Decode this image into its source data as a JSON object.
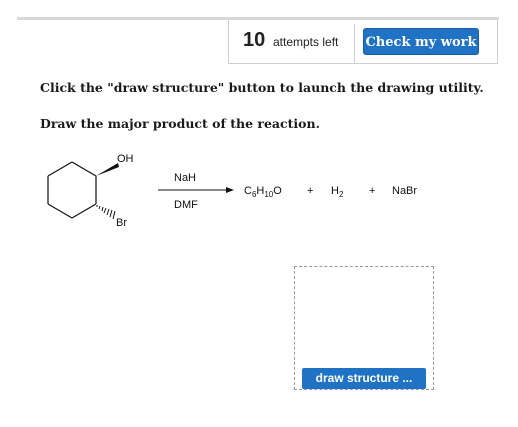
{
  "header": {
    "attempts_count": "10",
    "attempts_label": "attempts left",
    "check_button_label": "Check my work"
  },
  "instructions": {
    "line1": "Click the \"draw structure\" button to launch the drawing utility.",
    "line2": "Draw the major product of the reaction."
  },
  "reaction": {
    "reactant_oh": "OH",
    "reactant_br": "Br",
    "reagent_top": "NaH",
    "reagent_bottom": "DMF",
    "product_c": "C",
    "product_c_sub": "6",
    "product_h": "H",
    "product_h_sub": "10",
    "product_o": "O",
    "plus1": "+",
    "h2_h": "H",
    "h2_sub": "2",
    "plus2": "+",
    "nabr": "NaBr"
  },
  "draw_area": {
    "button_label": "draw structure ..."
  },
  "colors": {
    "accent_blue": "#1f72c4",
    "text": "#1a1a1a"
  }
}
